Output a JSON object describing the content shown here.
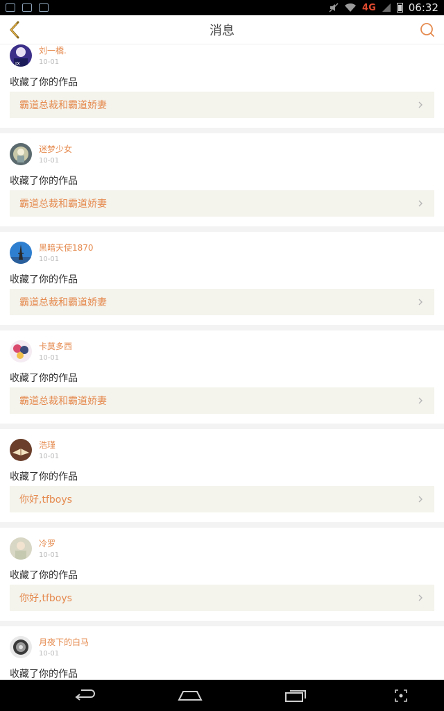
{
  "status_bar": {
    "network": "4G",
    "time": "06:32"
  },
  "header": {
    "title": "消息",
    "back_icon": "chevron-left-icon",
    "search_icon": "search-icon"
  },
  "colors": {
    "accent": "#e58a4e",
    "link_bg": "#f4f3ec",
    "divider": "#f3f3f3"
  },
  "messages": [
    {
      "user": "刘一橋.",
      "date": "10-01",
      "action": "收藏了你的作品",
      "work": "霸道总裁和霸道娇妻"
    },
    {
      "user": "迷梦少女",
      "date": "10-01",
      "action": "收藏了你的作品",
      "work": "霸道总裁和霸道娇妻"
    },
    {
      "user": "黑暗天使1870",
      "date": "10-01",
      "action": "收藏了你的作品",
      "work": "霸道总裁和霸道娇妻"
    },
    {
      "user": "卡莫多西",
      "date": "10-01",
      "action": "收藏了你的作品",
      "work": "霸道总裁和霸道娇妻"
    },
    {
      "user": "浩瑾",
      "date": "10-01",
      "action": "收藏了你的作品",
      "work": "你好,tfboys"
    },
    {
      "user": "冷罗",
      "date": "10-01",
      "action": "收藏了你的作品",
      "work": "你好,tfboys"
    },
    {
      "user": "月夜下的白马",
      "date": "10-01",
      "action": "收藏了你的作品",
      "work": ""
    }
  ]
}
